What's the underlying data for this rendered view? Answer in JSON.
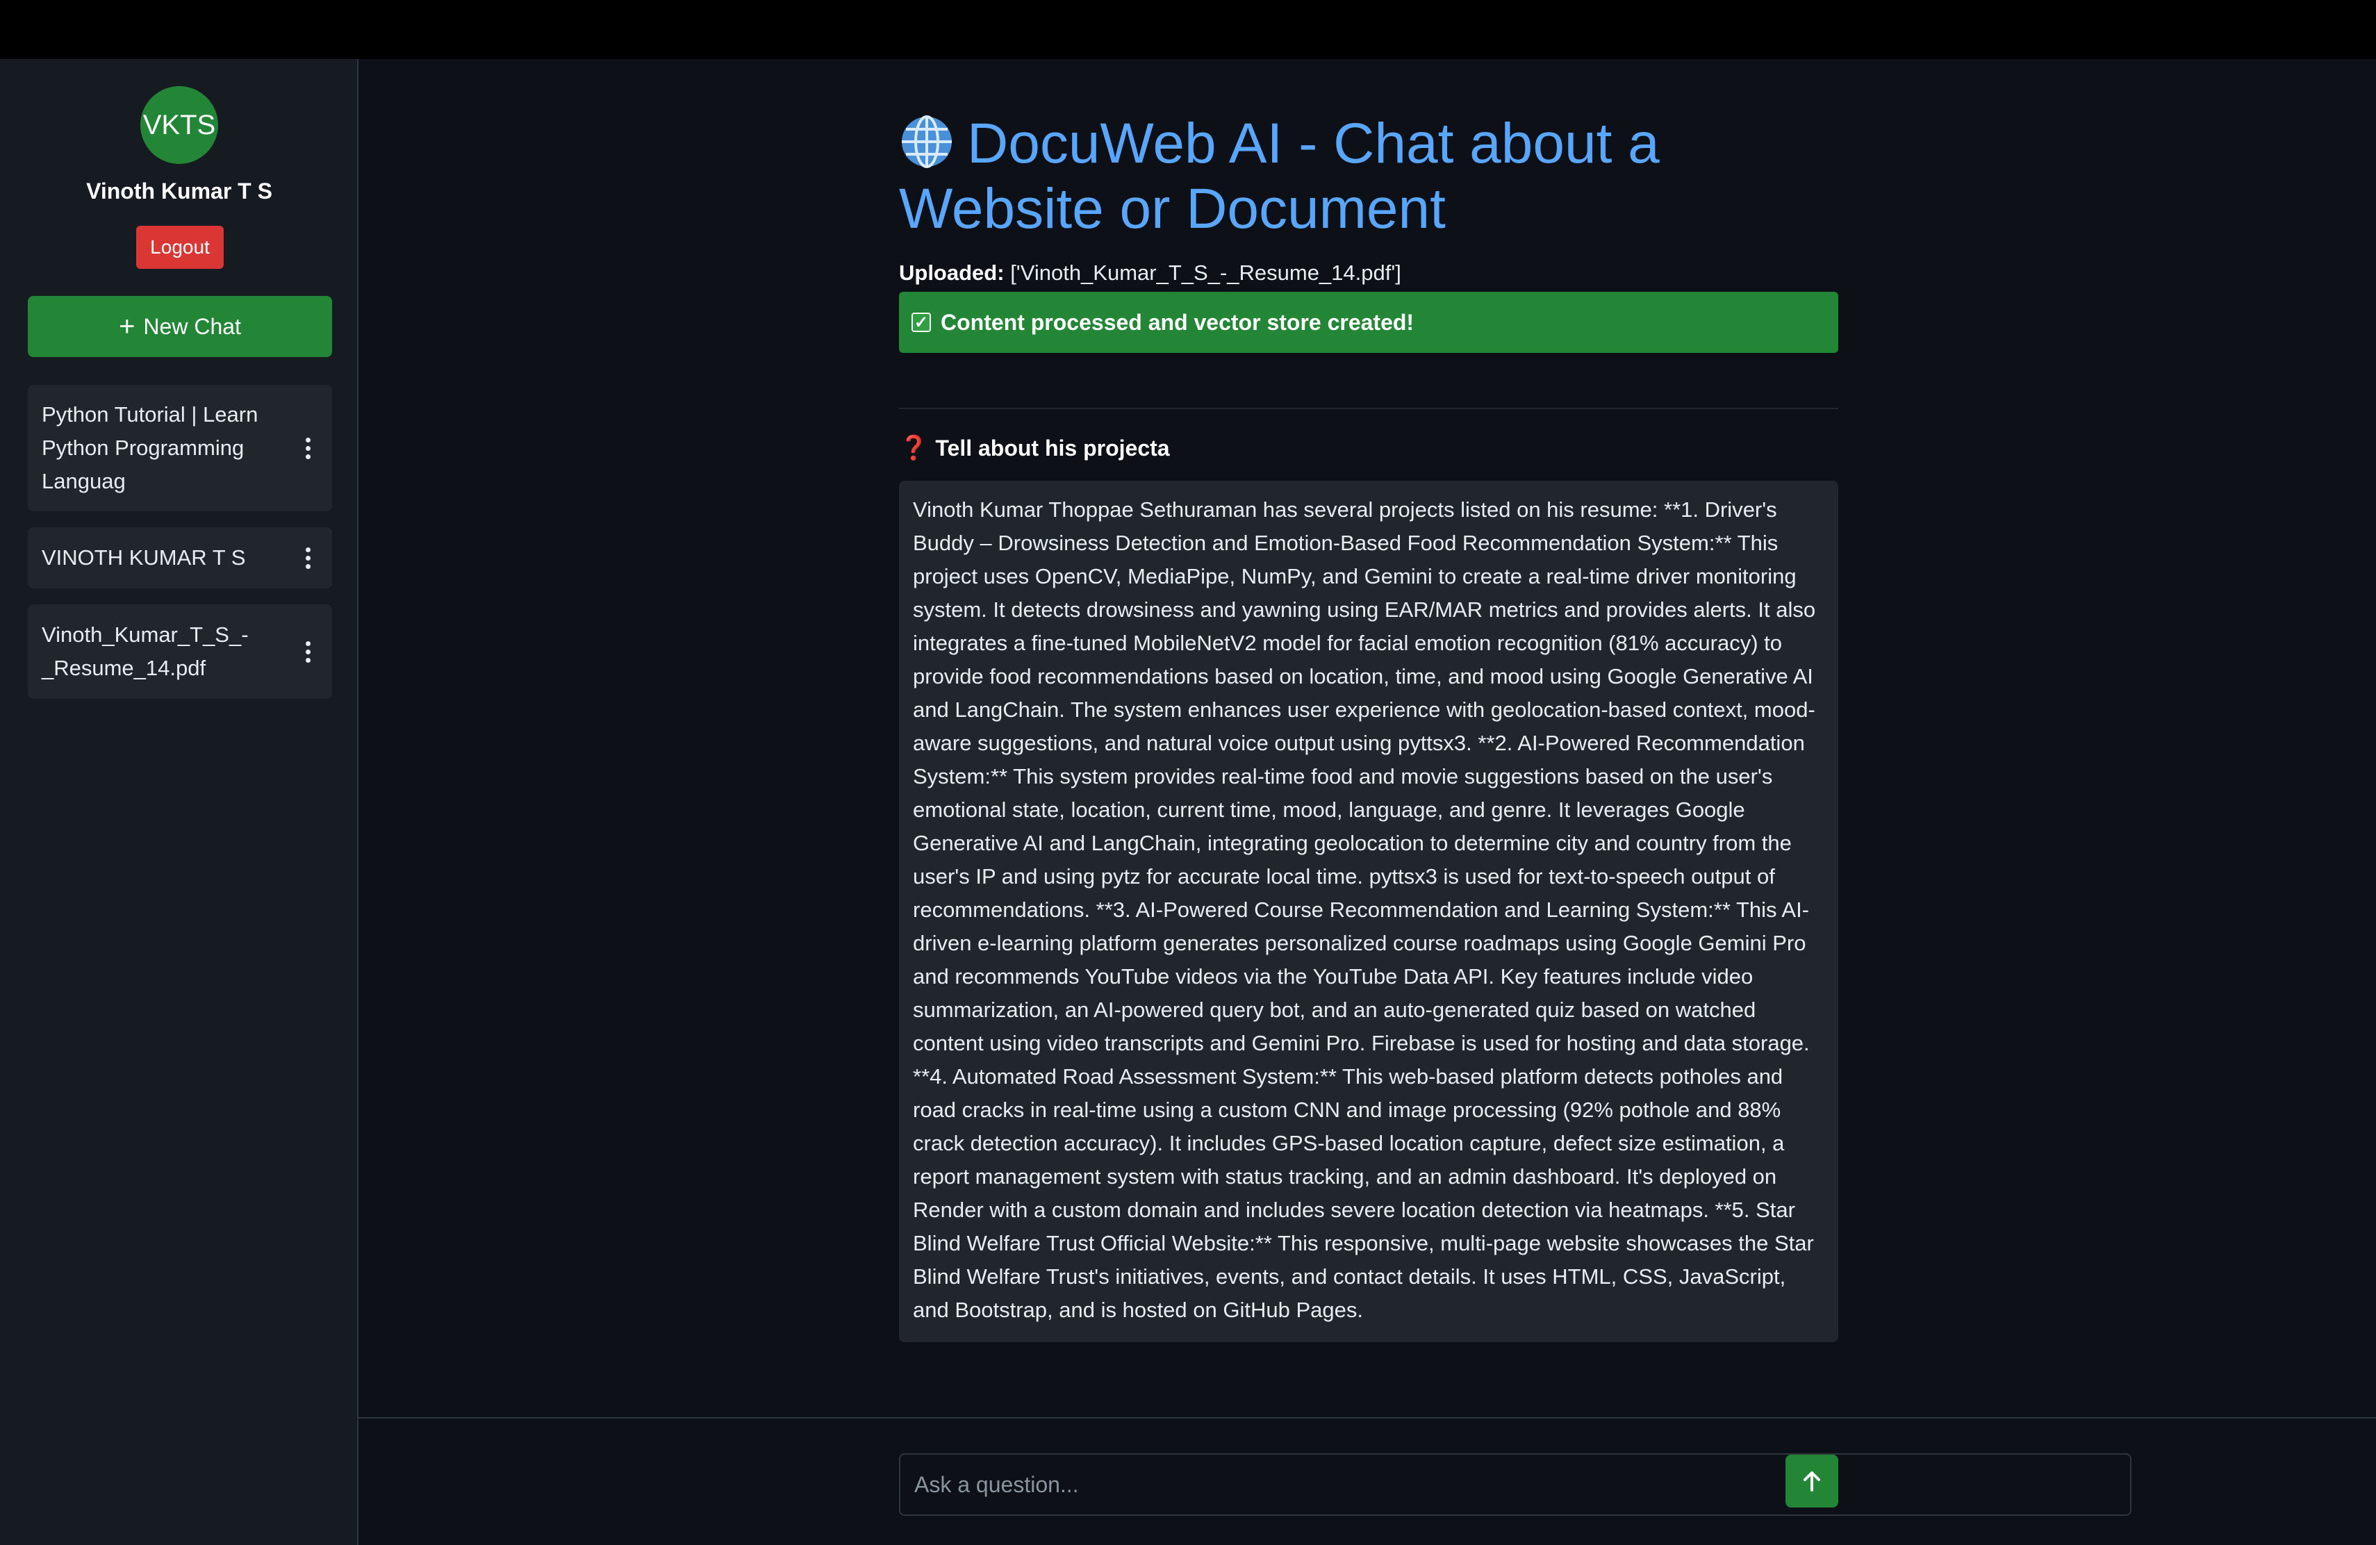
{
  "user": {
    "avatar_initials": "VKTS",
    "name": "Vinoth Kumar T S",
    "logout_label": "Logout"
  },
  "sidebar": {
    "new_chat_icon": "plus-icon",
    "new_chat_label": "New Chat",
    "chats": [
      {
        "label": "Python Tutorial | Learn Python Programming Languag"
      },
      {
        "label": "VINOTH KUMAR T S"
      },
      {
        "label": "Vinoth_Kumar_T_S_-_Resume_14.pdf"
      }
    ]
  },
  "main": {
    "title_icon": "globe-icon",
    "title": "DocuWeb AI - Chat about a Website or Document",
    "uploaded_label": "Uploaded:",
    "uploaded_value": "['Vinoth_Kumar_T_S_-_Resume_14.pdf']",
    "status_icon": "check-icon",
    "status_text": "Content processed and vector store created!",
    "question_icon": "question-mark-icon",
    "question": "Tell about his projecta",
    "answer": "Vinoth Kumar Thoppae Sethuraman has several projects listed on his resume: **1. Driver's Buddy – Drowsiness Detection and Emotion-Based Food Recommendation System:** This project uses OpenCV, MediaPipe, NumPy, and Gemini to create a real-time driver monitoring system. It detects drowsiness and yawning using EAR/MAR metrics and provides alerts. It also integrates a fine-tuned MobileNetV2 model for facial emotion recognition (81% accuracy) to provide food recommendations based on location, time, and mood using Google Generative AI and LangChain. The system enhances user experience with geolocation-based context, mood-aware suggestions, and natural voice output using pyttsx3. **2. AI-Powered Recommendation System:** This system provides real-time food and movie suggestions based on the user's emotional state, location, current time, mood, language, and genre. It leverages Google Generative AI and LangChain, integrating geolocation to determine city and country from the user's IP and using pytz for accurate local time. pyttsx3 is used for text-to-speech output of recommendations. **3. AI-Powered Course Recommendation and Learning System:** This AI-driven e-learning platform generates personalized course roadmaps using Google Gemini Pro and recommends YouTube videos via the YouTube Data API. Key features include video summarization, an AI-powered query bot, and an auto-generated quiz based on watched content using video transcripts and Gemini Pro. Firebase is used for hosting and data storage. **4. Automated Road Assessment System:** This web-based platform detects potholes and road cracks in real-time using a custom CNN and image processing (92% pothole and 88% crack detection accuracy). It includes GPS-based location capture, defect size estimation, a report management system with status tracking, and an admin dashboard. It's deployed on Render with a custom domain and includes severe location detection via heatmaps. **5. Star Blind Welfare Trust Official Website:** This responsive, multi-page website showcases the Star Blind Welfare Trust's initiatives, events, and contact details. It uses HTML, CSS, JavaScript, and Bootstrap, and is hosted on GitHub Pages."
  },
  "composer": {
    "placeholder": "Ask a question...",
    "send_icon": "arrow-up-icon"
  },
  "colors": {
    "accent_green": "#238636",
    "danger_red": "#da3633",
    "title_blue": "#58a6ff",
    "background": "#0d1117",
    "sidebar_bg": "#161b22",
    "card_bg": "#21262d"
  }
}
